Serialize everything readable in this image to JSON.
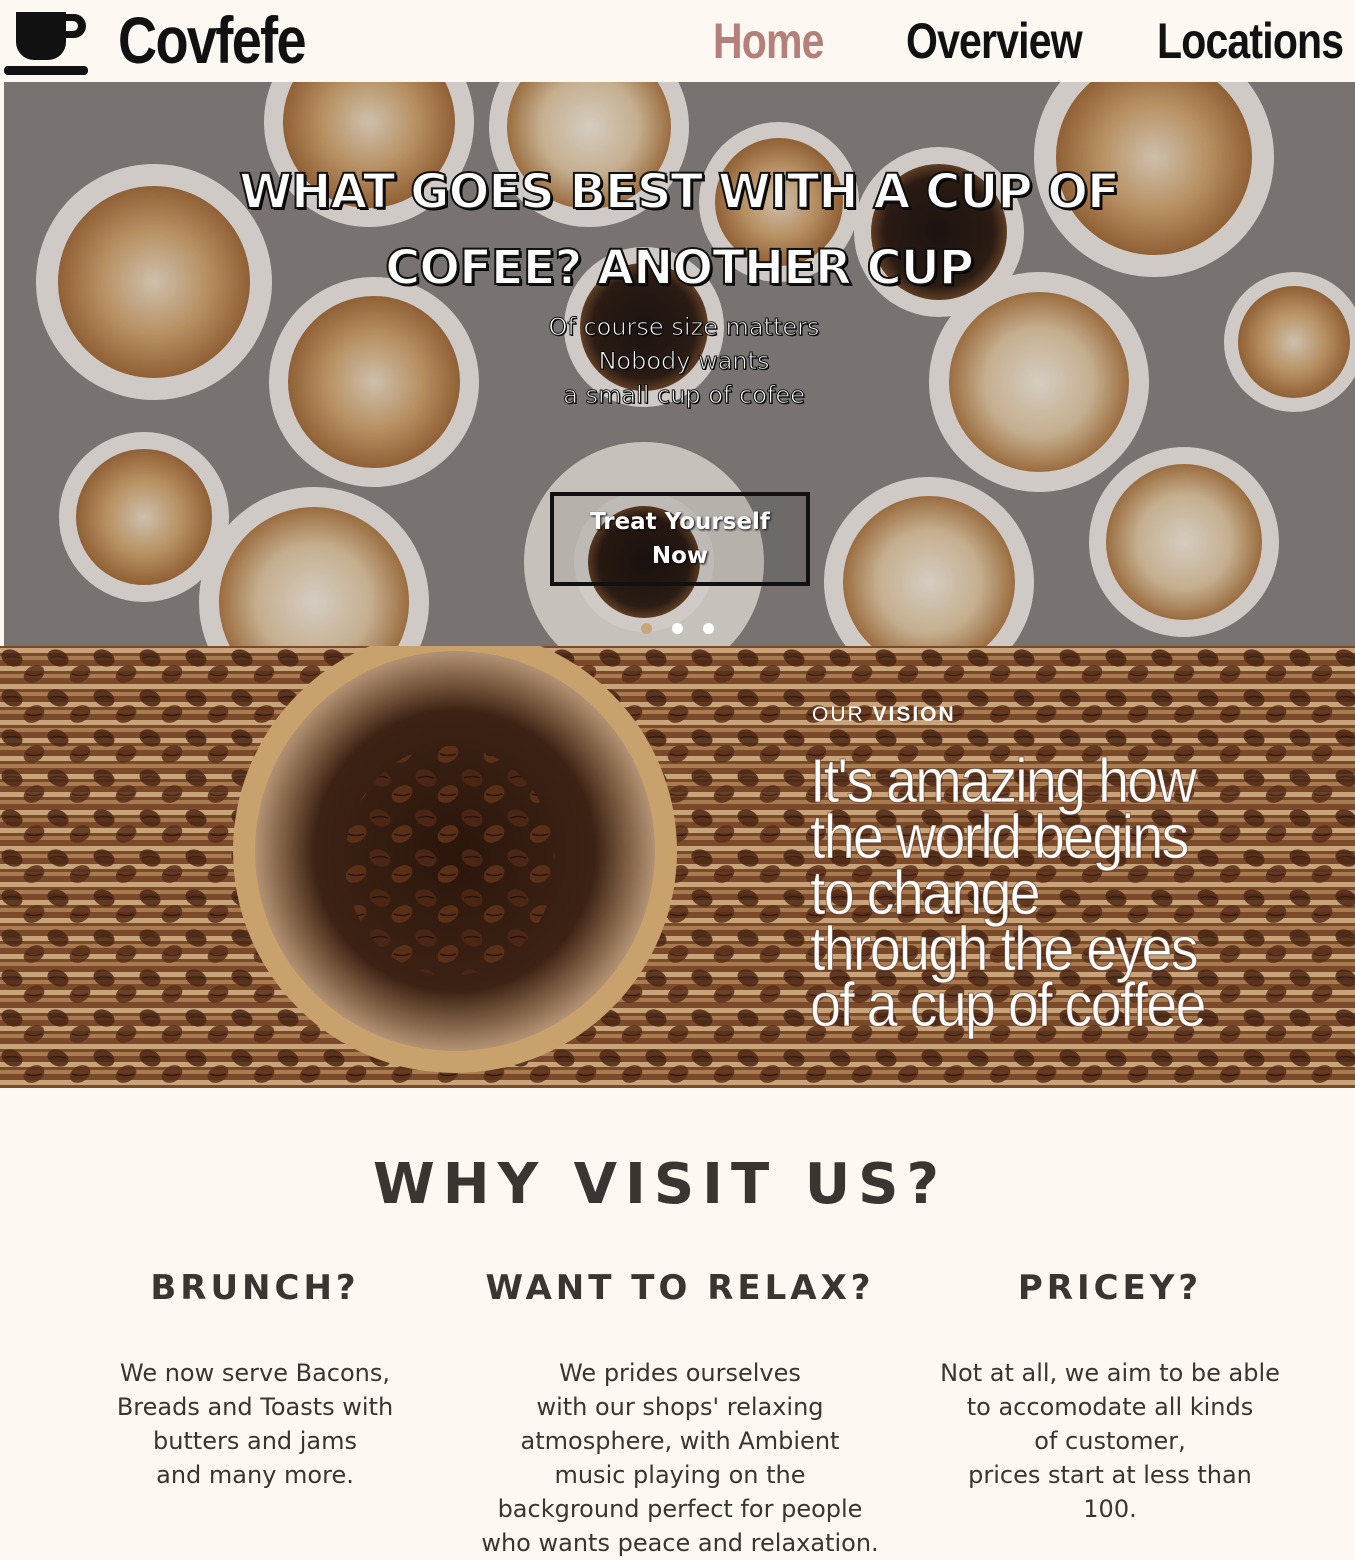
{
  "nav": {
    "brand": "Covfefe",
    "logo_icon": "coffee-cup-icon",
    "links": [
      {
        "label": "Home",
        "active": true
      },
      {
        "label": "Overview",
        "active": false
      },
      {
        "label": "Locations",
        "active": false
      }
    ],
    "active_color": "#b48079"
  },
  "hero": {
    "title": "WHAT GOES BEST WITH A CUP OF COFEE? ANOTHER CUP",
    "subtitle_lines": [
      "Of course size matters",
      "Nobody wants",
      "a small cup of cofee"
    ],
    "button_label": "Treat Yourself Now",
    "slides": 3,
    "active_slide": 1,
    "dot_active_color": "#c9a57a"
  },
  "vision": {
    "kicker_light": "OUR ",
    "kicker_bold": "VISION",
    "quote_lines": [
      "It's amazing how",
      "the world begins",
      "to change",
      "through the eyes",
      "of a cup of coffee"
    ]
  },
  "why": {
    "title": "WHY VISIT US?",
    "columns": [
      {
        "heading": "BRUNCH?",
        "text": "We now serve Bacons,\nBreads and Toasts with\nbutters and jams\nand many more."
      },
      {
        "heading": "WANT TO RELAX?",
        "text": "We prides ourselves\nwith our shops' relaxing\natmosphere, with Ambient\nmusic playing on the\nbackground perfect for people\nwho  wants peace and relaxation."
      },
      {
        "heading": "PRICEY?",
        "text": "Not at all, we aim to be able\nto accomodate all kinds\nof customer,\nprices start at less than\n100."
      }
    ]
  }
}
